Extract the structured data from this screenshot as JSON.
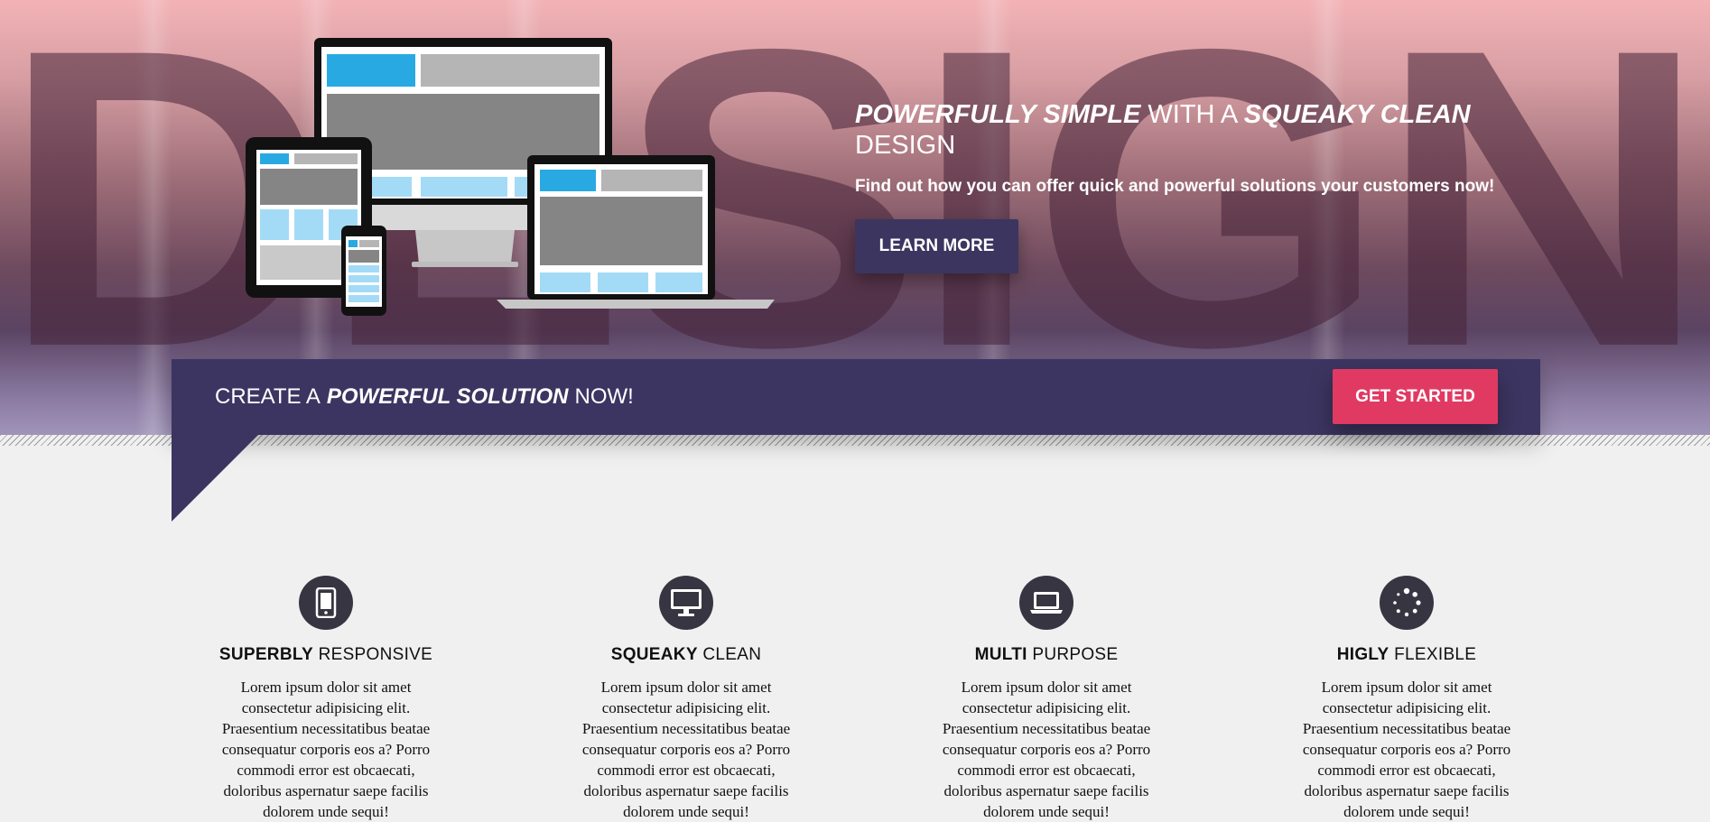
{
  "hero": {
    "background_word": "DESIGN",
    "headline": {
      "part1_emphasis": "POWERFULLY SIMPLE",
      "part2": "WITH A",
      "part3_emphasis": "SQUEAKY CLEAN",
      "part4": "DESIGN"
    },
    "subheadline": "Find out how you can offer quick and powerful solutions your customers now!",
    "learn_more_label": "LEARN MORE"
  },
  "cta": {
    "text_prefix": "CREATE A",
    "text_emphasis": "POWERFUL SOLUTION",
    "text_suffix": "NOW!",
    "get_started_label": "GET STARTED"
  },
  "features": [
    {
      "icon": "smartphone-icon",
      "title_bold": "SUPERBLY",
      "title_rest": "RESPONSIVE",
      "body": "Lorem ipsum dolor sit amet consectetur adipisicing elit. Praesentium necessitatibus beatae consequatur corporis eos a? Porro commodi error est obcaecati, doloribus aspernatur saepe facilis dolorem unde sequi!"
    },
    {
      "icon": "desktop-icon",
      "title_bold": "SQUEAKY",
      "title_rest": "CLEAN",
      "body": "Lorem ipsum dolor sit amet consectetur adipisicing elit. Praesentium necessitatibus beatae consequatur corporis eos a? Porro commodi error est obcaecati, doloribus aspernatur saepe facilis dolorem unde sequi!"
    },
    {
      "icon": "laptop-icon",
      "title_bold": "MULTI",
      "title_rest": "PURPOSE",
      "body": "Lorem ipsum dolor sit amet consectetur adipisicing elit. Praesentium necessitatibus beatae consequatur corporis eos a? Porro commodi error est obcaecati, doloribus aspernatur saepe facilis dolorem unde sequi!"
    },
    {
      "icon": "spinner-icon",
      "title_bold": "HIGLY",
      "title_rest": "FLEXIBLE",
      "body": "Lorem ipsum dolor sit amet consectetur adipisicing elit. Praesentium necessitatibus beatae consequatur corporis eos a? Porro commodi error est obcaecati, doloribus aspernatur saepe facilis dolorem unde sequi!"
    }
  ],
  "colors": {
    "banner": "#3c3561",
    "accent_button": "#e03a63",
    "icon_circle": "#383542"
  }
}
